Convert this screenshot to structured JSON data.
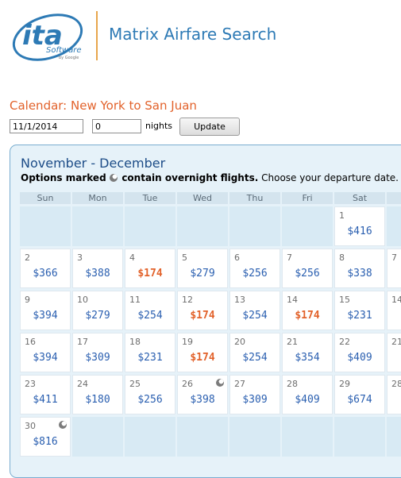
{
  "header": {
    "logo_text": "ita",
    "logo_sub": "Software",
    "logo_by": "by Google",
    "title": "Matrix Airfare Search"
  },
  "calendar_title": "Calendar: New York to San Juan",
  "form": {
    "date_value": "11/1/2014",
    "nights_value": "0",
    "nights_label": "nights",
    "update_label": "Update"
  },
  "panel": {
    "heading": "November - December",
    "legend_bold1": "Options marked",
    "legend_bold2": "contain overnight flights.",
    "legend_rest": "Choose your departure date."
  },
  "weekdays": [
    "Sun",
    "Mon",
    "Tue",
    "Wed",
    "Thu",
    "Fri",
    "Sat"
  ],
  "weeks": [
    [
      null,
      null,
      null,
      null,
      null,
      null,
      {
        "day": "1",
        "price": "$416",
        "low": false,
        "overnight": false
      }
    ],
    [
      {
        "day": "2",
        "price": "$366",
        "low": false,
        "overnight": false
      },
      {
        "day": "3",
        "price": "$388",
        "low": false,
        "overnight": false
      },
      {
        "day": "4",
        "price": "$174",
        "low": true,
        "overnight": false
      },
      {
        "day": "5",
        "price": "$279",
        "low": false,
        "overnight": false
      },
      {
        "day": "6",
        "price": "$256",
        "low": false,
        "overnight": false
      },
      {
        "day": "7",
        "price": "$256",
        "low": false,
        "overnight": false
      },
      {
        "day": "8",
        "price": "$338",
        "low": false,
        "overnight": false
      }
    ],
    [
      {
        "day": "9",
        "price": "$394",
        "low": false,
        "overnight": false
      },
      {
        "day": "10",
        "price": "$279",
        "low": false,
        "overnight": false
      },
      {
        "day": "11",
        "price": "$254",
        "low": false,
        "overnight": false
      },
      {
        "day": "12",
        "price": "$174",
        "low": true,
        "overnight": false
      },
      {
        "day": "13",
        "price": "$254",
        "low": false,
        "overnight": false
      },
      {
        "day": "14",
        "price": "$174",
        "low": true,
        "overnight": false
      },
      {
        "day": "15",
        "price": "$231",
        "low": false,
        "overnight": false
      }
    ],
    [
      {
        "day": "16",
        "price": "$394",
        "low": false,
        "overnight": false
      },
      {
        "day": "17",
        "price": "$309",
        "low": false,
        "overnight": false
      },
      {
        "day": "18",
        "price": "$231",
        "low": false,
        "overnight": false
      },
      {
        "day": "19",
        "price": "$174",
        "low": true,
        "overnight": false
      },
      {
        "day": "20",
        "price": "$254",
        "low": false,
        "overnight": false
      },
      {
        "day": "21",
        "price": "$354",
        "low": false,
        "overnight": false
      },
      {
        "day": "22",
        "price": "$409",
        "low": false,
        "overnight": false
      }
    ],
    [
      {
        "day": "23",
        "price": "$411",
        "low": false,
        "overnight": false
      },
      {
        "day": "24",
        "price": "$180",
        "low": false,
        "overnight": false
      },
      {
        "day": "25",
        "price": "$256",
        "low": false,
        "overnight": false
      },
      {
        "day": "26",
        "price": "$398",
        "low": false,
        "overnight": true
      },
      {
        "day": "27",
        "price": "$309",
        "low": false,
        "overnight": false
      },
      {
        "day": "28",
        "price": "$409",
        "low": false,
        "overnight": false
      },
      {
        "day": "29",
        "price": "$674",
        "low": false,
        "overnight": false
      }
    ],
    [
      {
        "day": "30",
        "price": "$816",
        "low": false,
        "overnight": true
      },
      null,
      null,
      null,
      null,
      null,
      null
    ]
  ],
  "next_month_cells": [
    "7",
    "14",
    "21",
    "28"
  ],
  "colors": {
    "accent_orange": "#e2622b",
    "price_blue": "#2a5fb0",
    "title_blue": "#2d7ab5",
    "panel_bg": "#e6f2f9"
  }
}
